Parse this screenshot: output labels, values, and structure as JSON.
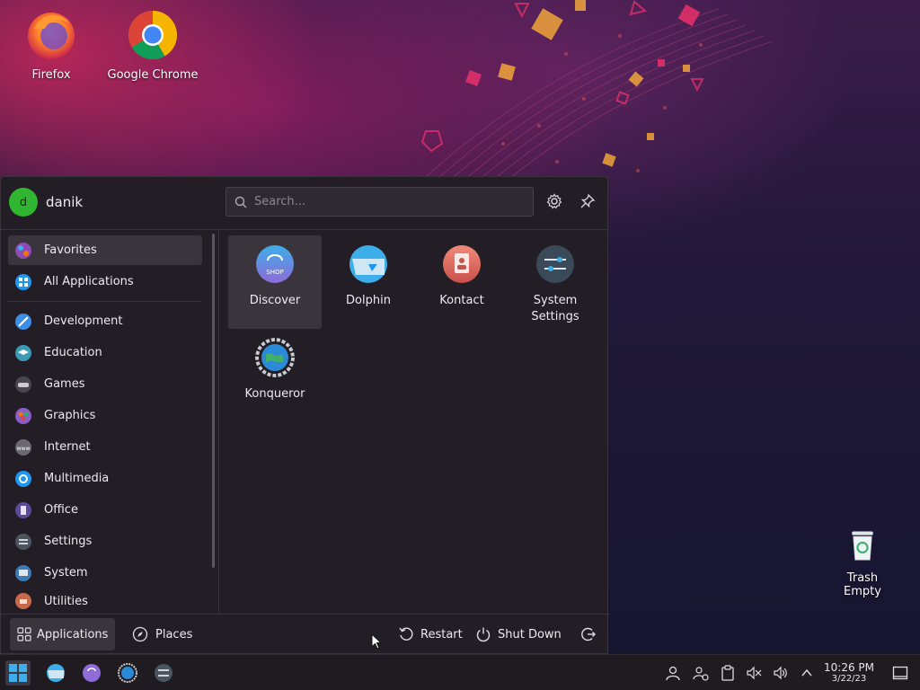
{
  "desktop": {
    "icons": [
      {
        "label": "Firefox",
        "icon": "firefox-icon"
      },
      {
        "label": "Google Chrome",
        "icon": "chrome-icon"
      }
    ],
    "trash": {
      "line1": "Trash",
      "line2": "Empty",
      "icon": "trash-icon"
    }
  },
  "launcher": {
    "user": {
      "initial": "d",
      "name": "danik",
      "avatar_color": "#2fb52f"
    },
    "search": {
      "placeholder": "Search..."
    },
    "header_buttons": [
      "settings-icon",
      "pin-icon"
    ],
    "categories": [
      {
        "label": "Favorites",
        "icon": "favorites-icon",
        "active": true
      },
      {
        "label": "All Applications",
        "icon": "all-apps-icon"
      },
      {
        "label": "Development",
        "icon": "development-icon"
      },
      {
        "label": "Education",
        "icon": "education-icon"
      },
      {
        "label": "Games",
        "icon": "games-icon"
      },
      {
        "label": "Graphics",
        "icon": "graphics-icon"
      },
      {
        "label": "Internet",
        "icon": "internet-icon"
      },
      {
        "label": "Multimedia",
        "icon": "multimedia-icon"
      },
      {
        "label": "Office",
        "icon": "office-icon"
      },
      {
        "label": "Settings",
        "icon": "settings-category-icon"
      },
      {
        "label": "System",
        "icon": "system-icon"
      },
      {
        "label": "Utilities",
        "icon": "utilities-icon"
      }
    ],
    "apps": [
      {
        "label": "Discover",
        "icon": "discover-icon",
        "active": true,
        "icon_text": "SHOP"
      },
      {
        "label": "Dolphin",
        "icon": "dolphin-icon"
      },
      {
        "label": "Kontact",
        "icon": "kontact-icon"
      },
      {
        "label": "System Settings",
        "line1": "System",
        "line2": "Settings",
        "icon": "system-settings-icon"
      },
      {
        "label": "Konqueror",
        "icon": "konqueror-icon"
      }
    ],
    "footer": {
      "tabs": [
        {
          "label": "Applications",
          "icon": "applications-grid-icon",
          "active": true
        },
        {
          "label": "Places",
          "icon": "compass-icon"
        }
      ],
      "actions": [
        {
          "label": "Restart",
          "icon": "restart-icon"
        },
        {
          "label": "Shut Down",
          "icon": "power-icon"
        },
        {
          "label": "",
          "icon": "logout-icon"
        }
      ]
    }
  },
  "taskbar": {
    "launchers": [
      "app-launcher-icon",
      "dolphin-taskbar-icon",
      "discover-taskbar-icon",
      "konqueror-taskbar-icon",
      "system-settings-taskbar-icon"
    ],
    "tray": [
      "user-icon",
      "user-switch-icon",
      "clipboard-icon",
      "mute-icon",
      "volume-icon",
      "chevron-up-icon"
    ],
    "clock": {
      "time": "10:26 PM",
      "date": "3/22/23"
    },
    "show_desktop": "show-desktop-icon"
  },
  "colors": {
    "accent": "#3daee9",
    "panel": "#231e25",
    "highlight": "#3a353c"
  }
}
